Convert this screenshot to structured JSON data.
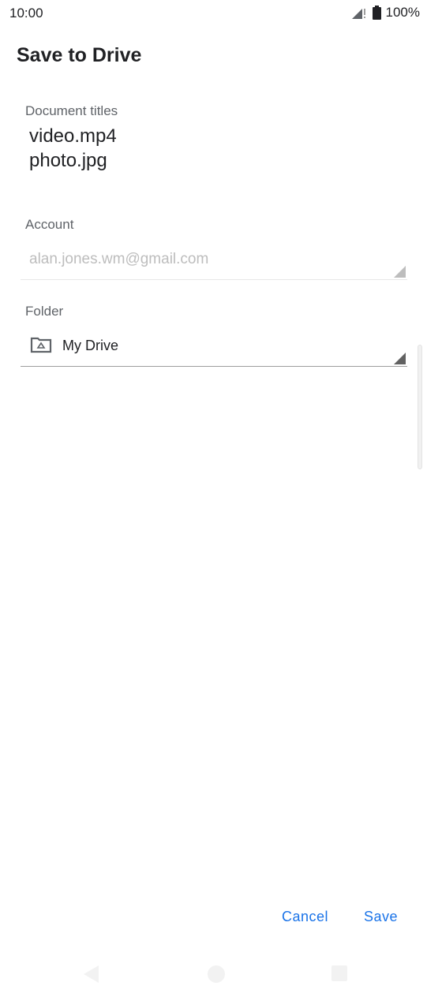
{
  "status_bar": {
    "time": "10:00",
    "battery": "100%"
  },
  "dialog": {
    "title": "Save to Drive",
    "document_titles": {
      "label": "Document titles",
      "items": [
        "video.mp4",
        "photo.jpg"
      ]
    },
    "account": {
      "label": "Account",
      "value": "alan.jones.wm@gmail.com"
    },
    "folder": {
      "label": "Folder",
      "value": "My Drive",
      "icon": "drive-folder-icon"
    },
    "actions": {
      "cancel_label": "Cancel",
      "save_label": "Save"
    }
  },
  "colors": {
    "accent": "#1a73e8",
    "text_primary": "#202124",
    "text_secondary": "#5f6368",
    "text_disabled": "#bdbdbd"
  }
}
